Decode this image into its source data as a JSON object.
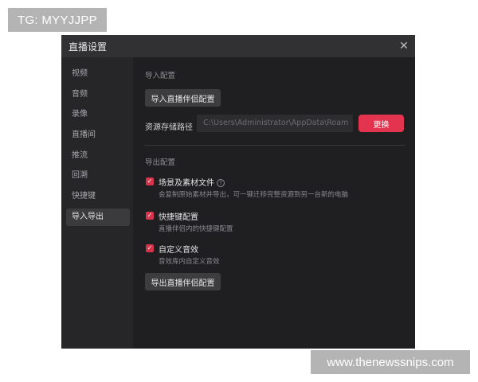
{
  "watermarks": {
    "top": "TG: MYYJJPP",
    "bottom": "www.thenewssnips.com"
  },
  "dialog": {
    "title": "直播设置",
    "close_icon": "close-icon"
  },
  "sidebar": {
    "items": [
      {
        "label": "视频"
      },
      {
        "label": "音频"
      },
      {
        "label": "录像"
      },
      {
        "label": "直播间"
      },
      {
        "label": "推流"
      },
      {
        "label": "回溯"
      },
      {
        "label": "快捷键"
      },
      {
        "label": "导入导出",
        "active": true
      }
    ]
  },
  "import_section": {
    "label": "导入配置",
    "import_button": "导入直播伴侣配置",
    "path_label": "资源存储路径",
    "path_value": "C:\\Users\\Administrator\\AppData\\Roam",
    "change_button": "更换"
  },
  "export_section": {
    "label": "导出配置",
    "options": [
      {
        "title": "场景及素材文件",
        "desc": "会复制原始素材并导出，可一键迁移完整资源到另一台新的电脑",
        "checked": true,
        "has_info": true
      },
      {
        "title": "快捷键配置",
        "desc": "直播伴侣内的快捷键配置",
        "checked": true
      },
      {
        "title": "自定义音效",
        "desc": "音效库内自定义音效",
        "checked": true
      }
    ],
    "export_button": "导出直播伴侣配置"
  },
  "colors": {
    "accent": "#e2344f",
    "panel": "#262628",
    "content": "#1f1f21"
  }
}
